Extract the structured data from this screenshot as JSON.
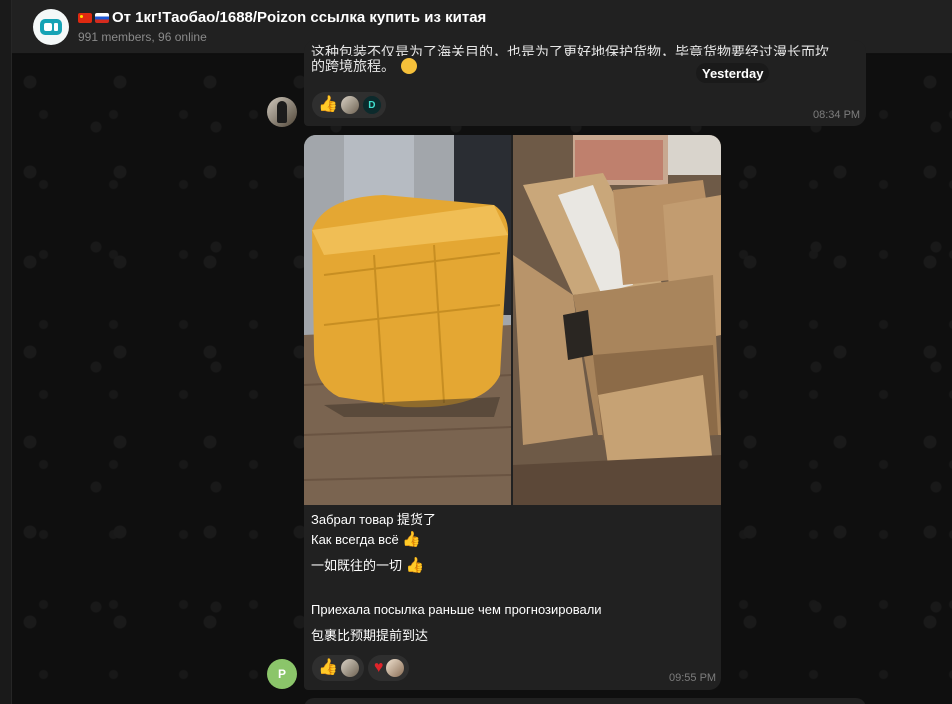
{
  "header": {
    "title": "От 1кг!Таобао/1688/Poizon ссылка купить из китая",
    "subtitle": "991 members, 96 online"
  },
  "messages": {
    "previous": {
      "text_line_partial": "这种包装不仅是为了海关目的，也是为了更好地保护货物，毕竟货物要经过漫长而坎坷",
      "text_line": "的跨境旅程。",
      "time": "08:34 PM",
      "reactions": [
        {
          "emoji": "thumbs-up",
          "count_avatars": 2
        }
      ]
    },
    "date_separator": "Yesterday",
    "current": {
      "lines": [
        "Забрал товар 提货了",
        "Как всегда всё",
        "一如既往的一切",
        "",
        "Приехала посылка раньше чем прогнозировали",
        "包裹比预期提前到达"
      ],
      "time": "09:55 PM",
      "sender_initial": "P",
      "reactions": [
        {
          "emoji": "thumbs-up",
          "avatars": 1
        },
        {
          "emoji": "heart",
          "avatars": 1
        }
      ],
      "photos": [
        {
          "description_icon": "photo-icon"
        },
        {
          "description_icon": "photo-icon"
        }
      ]
    }
  },
  "colors": {
    "header_bg": "#212121",
    "bubble_bg": "#212121",
    "chat_bg": "#0f0f0f",
    "reaction_bg": "#2f2f2f",
    "heart": "#e0242a",
    "thumb": "#f1b64b"
  }
}
